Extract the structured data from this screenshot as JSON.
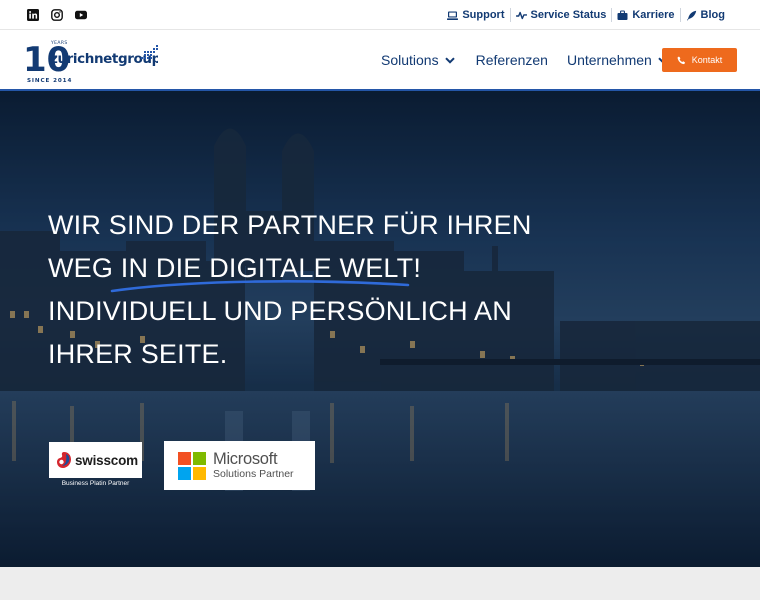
{
  "colors": {
    "brand_navy": "#123a73",
    "accent_blue": "#2456a8",
    "cta_orange": "#ee6a1d",
    "hero_text": "#ffffff",
    "microsoft": [
      "#f25022",
      "#7fba00",
      "#00a4ef",
      "#ffb900"
    ]
  },
  "social": [
    {
      "icon": "linkedin-icon"
    },
    {
      "icon": "instagram-icon"
    },
    {
      "icon": "youtube-icon"
    }
  ],
  "utility_nav": [
    {
      "label": "Support",
      "icon": "support-desk-icon"
    },
    {
      "label": "Service Status",
      "icon": "pulse-icon"
    },
    {
      "label": "Karriere",
      "icon": "briefcase-icon"
    },
    {
      "label": "Blog",
      "icon": "quill-icon"
    }
  ],
  "logo": {
    "badge_number": "10",
    "badge_word": "YEARS",
    "wordmark": "zurichnetgroup",
    "since": "SINCE 2014"
  },
  "main_nav": [
    {
      "label": "Solutions",
      "has_dropdown": true
    },
    {
      "label": "Referenzen",
      "has_dropdown": false
    },
    {
      "label": "Unternehmen",
      "has_dropdown": true
    }
  ],
  "cta": {
    "label": "Kontakt",
    "icon": "phone-icon"
  },
  "hero": {
    "lines": [
      "Wir sind der Partner für Ihren",
      "Weg in die digitale Welt!",
      "Individuell und persönlich an",
      "Ihrer Seite."
    ],
    "background": "zurich-night-skyline"
  },
  "partners": {
    "swisscom": {
      "name": "swisscom",
      "subtitle": "Business Platin Partner"
    },
    "microsoft": {
      "name": "Microsoft",
      "subtitle": "Solutions Partner"
    }
  }
}
